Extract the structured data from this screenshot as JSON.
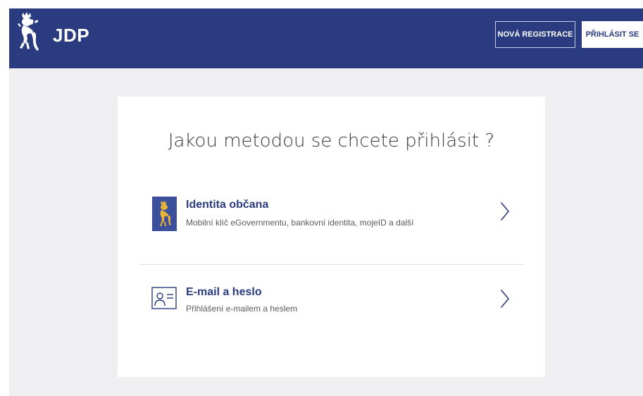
{
  "header": {
    "brand": "JDP",
    "logo_icon": "czech-lion-icon",
    "register_label": "NOVÁ REGISTRACE",
    "login_label": "PŘIHLÁSIT SE",
    "colors": {
      "bar": "#2b3b80",
      "page_bg": "#efeff1"
    }
  },
  "main": {
    "title": "Jakou metodou se chcete přihlásit ?",
    "methods": [
      {
        "title": "Identita občana",
        "subtitle": "Mobilní klíč eGovernmentu, bankovní identita, mojeID a další",
        "icon": "citizen-identity-icon",
        "chevron": "chevron-right-icon"
      },
      {
        "title": "E-mail a heslo",
        "subtitle": "Přihlášení e-mailem a heslem",
        "icon": "id-card-icon",
        "chevron": "chevron-right-icon"
      }
    ]
  }
}
